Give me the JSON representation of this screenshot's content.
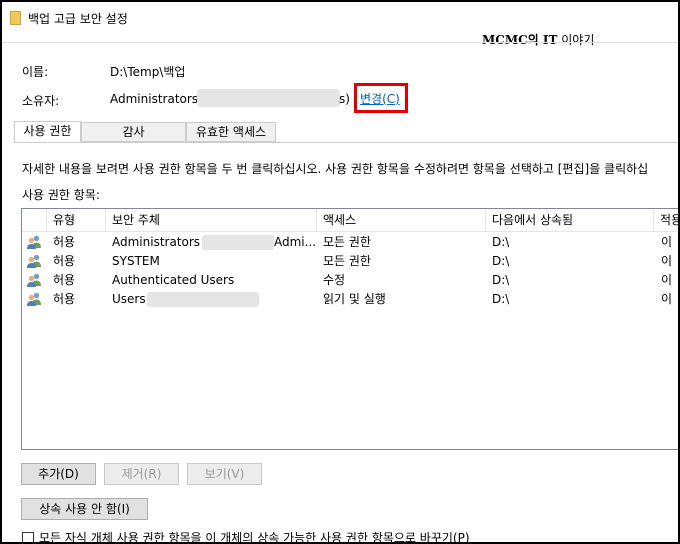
{
  "window": {
    "title": "백업 고급 보안 설정"
  },
  "watermark": {
    "part1": "MCMC의 IT",
    "part2": " 이야기"
  },
  "info": {
    "name_label": "이름:",
    "name_value": "D:\\Temp\\백업",
    "owner_label": "소유자:",
    "owner_value_prefix": "Administrators (",
    "owner_value_suffix": "s)",
    "change_link": "변경(C)"
  },
  "tabs": [
    {
      "label": "사용 권한",
      "active": true
    },
    {
      "label": "감사",
      "active": false
    },
    {
      "label": "유효한 액세스",
      "active": false
    }
  ],
  "help_text": "자세한 내용을 보려면 사용 권한 항목을 두 번 클릭하십시오. 사용 권한 항목을 수정하려면 항목을 선택하고 [편집]을 클릭하십",
  "entries_label": "사용 권한 항목:",
  "table": {
    "columns": [
      "유형",
      "보안 주체",
      "액세스",
      "다음에서 상속됨",
      "적용"
    ],
    "rows": [
      {
        "type": "허용",
        "principal_prefix": "Administrators (C",
        "principal_suffix": "Admi...",
        "access": "모든 권한",
        "inherited": "D:\\",
        "applies": "이 "
      },
      {
        "type": "허용",
        "principal_prefix": "SYSTEM",
        "principal_suffix": "",
        "access": "모든 권한",
        "inherited": "D:\\",
        "applies": "이 "
      },
      {
        "type": "허용",
        "principal_prefix": "Authenticated Users",
        "principal_suffix": "",
        "access": "수정",
        "inherited": "D:\\",
        "applies": "이 "
      },
      {
        "type": "허용",
        "principal_prefix": "Users (",
        "principal_suffix": "",
        "access": "읽기 및 실행",
        "inherited": "D:\\",
        "applies": "이 "
      }
    ]
  },
  "buttons": {
    "add": "추가(D)",
    "remove": "제거(R)",
    "view": "보기(V)",
    "disable_inheritance": "상속 사용 안 함(I)"
  },
  "replace_checkbox": {
    "label": "모든 자식 개체 사용 권한 항목을 이 개체의 상속 가능한 사용 권한 항목으로 바꾸기(P)",
    "checked": false
  }
}
